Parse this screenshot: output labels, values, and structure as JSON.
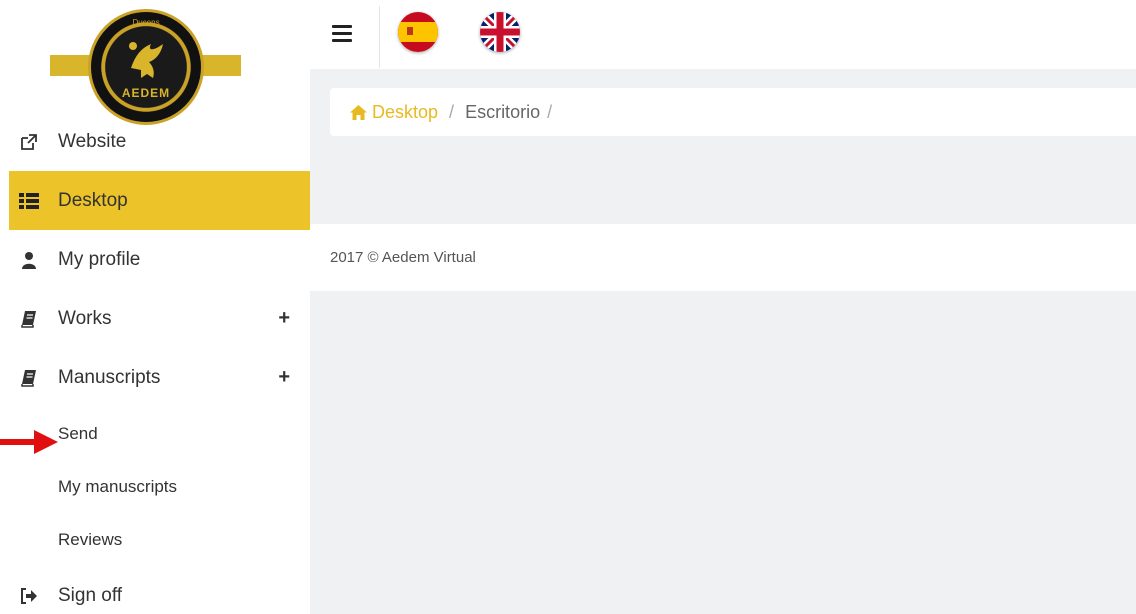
{
  "logo": {
    "text": "AEDEM",
    "top_text": "Ducens"
  },
  "sidebar": {
    "items": [
      {
        "label": "Website",
        "icon": "external-link-icon"
      },
      {
        "label": "Desktop",
        "icon": "list-icon",
        "active": true
      },
      {
        "label": "My profile",
        "icon": "user-icon"
      },
      {
        "label": "Works",
        "icon": "book-icon",
        "expand": "+"
      },
      {
        "label": "Manuscripts",
        "icon": "book-icon",
        "expand": "+"
      }
    ],
    "sub_items": [
      {
        "label": "Send"
      },
      {
        "label": "My manuscripts"
      },
      {
        "label": "Reviews"
      }
    ],
    "signoff": {
      "label": "Sign off",
      "icon": "sign-out-icon"
    }
  },
  "breadcrumb": {
    "home": "Desktop",
    "sep": "/",
    "current": "Escritorio",
    "trailing_sep": "/"
  },
  "footer": {
    "text": "2017 © Aedem Virtual"
  },
  "colors": {
    "accent": "#ecc42a",
    "link": "#e8b920",
    "bg": "#eff1f2",
    "annotation": "#e01010"
  }
}
